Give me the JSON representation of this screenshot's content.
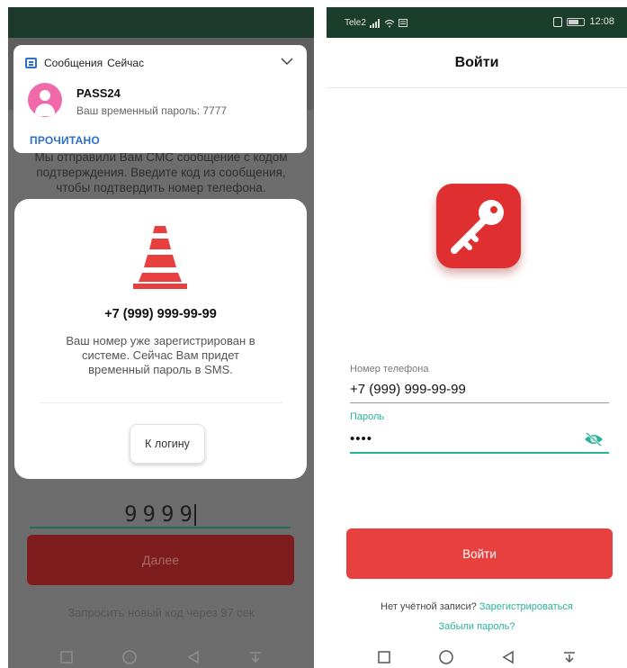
{
  "left_screen": {
    "background": {
      "instructions": "Мы отправили Вам СМС сообщение с кодом подтверждения. Введите код из сообщения, чтобы подтвердить номер телефона.",
      "code_value": "9999",
      "next_button_label": "Далее",
      "resend_text": "Запросить новый код через 97 сек"
    },
    "notification": {
      "app_name": "Сообщения",
      "time": "Сейчас",
      "sender": "PASS24",
      "text": "Ваш временный пароль: 7777",
      "action_label": "ПРОЧИТАНО"
    },
    "dialog": {
      "phone": "+7 (999) 999-99-99",
      "message": "Ваш номер уже зарегистрирован в системе. Сейчас Вам придет временный пароль в SMS.",
      "button_label": "К логину"
    }
  },
  "right_screen": {
    "status_bar": {
      "carrier": "Tele2",
      "time": "12:08"
    },
    "header_title": "Войти",
    "form": {
      "phone_label": "Номер телефона",
      "phone_value": "+7 (999) 999-99-99",
      "password_label": "Пароль",
      "password_value": "••••"
    },
    "login_button_label": "Войти",
    "no_account_text": "Нет учётной записи?",
    "register_link": "Зарегистрироваться",
    "forgot_link": "Забыли пароль?"
  },
  "colors": {
    "accent_red": "#e8403e",
    "accent_teal": "#27b39a",
    "status_bar": "#1b3d2c",
    "notification_link": "#2b6fc7"
  },
  "icons": [
    "messages-app-icon",
    "chevron-down-icon",
    "avatar-icon",
    "traffic-cone-icon",
    "key-logo-icon",
    "eye-toggle-icon",
    "nav-square-icon",
    "nav-circle-icon",
    "nav-back-icon",
    "nav-download-icon"
  ]
}
